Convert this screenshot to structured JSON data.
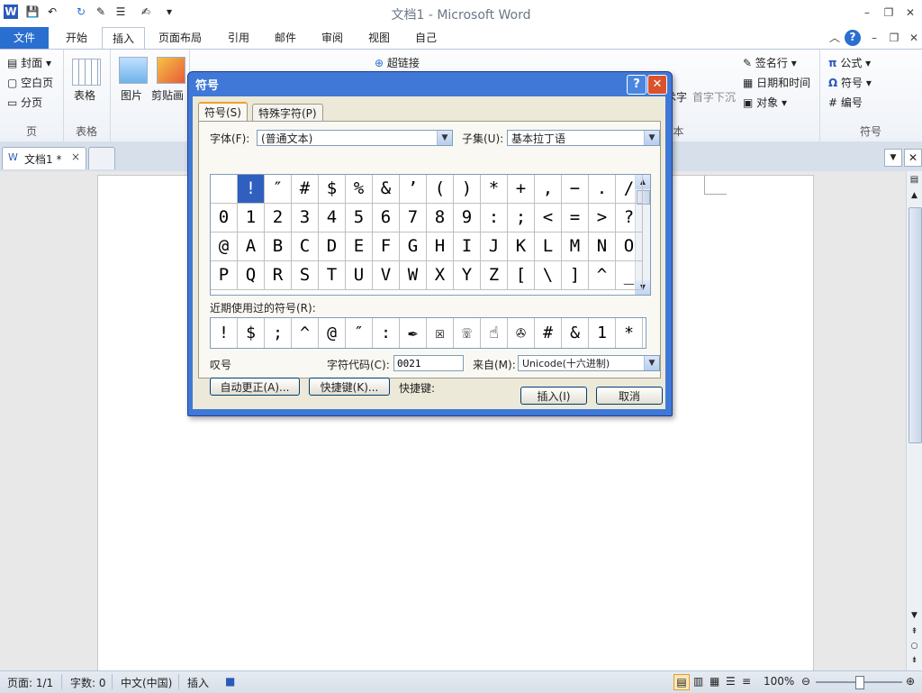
{
  "window": {
    "title": "文档1 - Microsoft Word",
    "min_icon": "minimize-icon",
    "max_icon": "restore-icon",
    "close_icon": "close-icon"
  },
  "ribbon_tabs": [
    "文件",
    "开始",
    "插入",
    "页面布局",
    "引用",
    "邮件",
    "审阅",
    "视图",
    "自己"
  ],
  "ribbon": {
    "pages": {
      "label": "页",
      "items": [
        "封面",
        "空白页",
        "分页"
      ]
    },
    "table": {
      "label": "表格",
      "item": "表格"
    },
    "illustrations": {
      "picture": "图片",
      "clipart": "剪贴画"
    },
    "links": {
      "hyperlink": "超链接"
    },
    "text": {
      "label": "文本",
      "partial": "术字",
      "dropcap": "首字下沉",
      "signature": "签名行",
      "datetime": "日期和时间",
      "object": "对象"
    },
    "symbols": {
      "label": "符号",
      "formula": "公式",
      "symbol": "符号",
      "number": "编号",
      "formula_glyph": "π",
      "symbol_glyph": "Ω"
    }
  },
  "document_tab": {
    "label": "文档1 *",
    "close": "×"
  },
  "dialog": {
    "title": "符号",
    "help": "?",
    "close": "✕",
    "tabs": [
      "符号(S)",
      "特殊字符(P)"
    ],
    "font_label": "字体(F):",
    "font_value": "(普通文本)",
    "subset_label": "子集(U):",
    "subset_value": "基本拉丁语",
    "grid_rows": [
      [
        " ",
        "!",
        "″",
        "#",
        "$",
        "%",
        "&",
        "’",
        "(",
        ")",
        "*",
        "+",
        ",",
        "−",
        ".",
        "/"
      ],
      [
        "0",
        "1",
        "2",
        "3",
        "4",
        "5",
        "6",
        "7",
        "8",
        "9",
        ":",
        ";",
        "<",
        "=",
        ">",
        "?"
      ],
      [
        "@",
        "A",
        "B",
        "C",
        "D",
        "E",
        "F",
        "G",
        "H",
        "I",
        "J",
        "K",
        "L",
        "M",
        "N",
        "O"
      ],
      [
        "P",
        "Q",
        "R",
        "S",
        "T",
        "U",
        "V",
        "W",
        "X",
        "Y",
        "Z",
        "[",
        "\\",
        "]",
        "^",
        "_"
      ]
    ],
    "selected_row": 0,
    "selected_col": 1,
    "recent_label": "近期使用过的符号(R):",
    "recent": [
      "!",
      "$",
      ";",
      "^",
      "@",
      "″",
      ":",
      "✒",
      "☒",
      "☏",
      "☝",
      "✇",
      "#",
      "&",
      "1",
      "*"
    ],
    "char_name": "叹号",
    "code_label": "字符代码(C):",
    "code_value": "0021",
    "from_label": "来自(M):",
    "from_value": "Unicode(十六进制)",
    "autocorrect_btn": "自动更正(A)...",
    "shortcut_btn": "快捷键(K)...",
    "shortcut_label": "快捷键:",
    "insert_btn": "插入(I)",
    "cancel_btn": "取消"
  },
  "status": {
    "page": "页面: 1/1",
    "words": "字数: 0",
    "lang": "中文(中国)",
    "mode": "插入",
    "zoom": "100%"
  },
  "colors": {
    "file_tab": "#2a6fd0",
    "dialog_frame": "#3f78d6",
    "selection": "#2f5fbf"
  }
}
